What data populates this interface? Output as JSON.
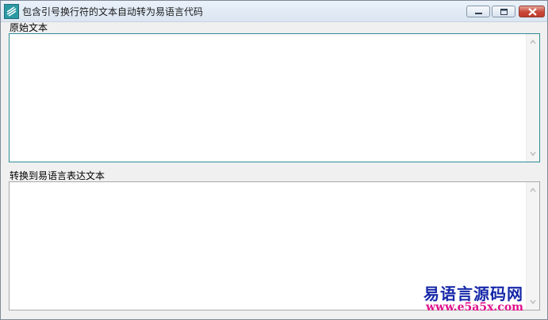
{
  "window": {
    "title": "包含引号换行符的文本自动转为易语言代码",
    "icon": "app-icon"
  },
  "controls": {
    "minimize": "minimize-icon",
    "maximize": "maximize-icon",
    "close": "close-icon"
  },
  "source": {
    "label": "原始文本",
    "value": ""
  },
  "output": {
    "label": "转换到易语言表达文本",
    "value": ""
  },
  "watermark": {
    "site_name": "易语言源码网",
    "url": "www.e5a5x.com"
  },
  "colors": {
    "title_bar": "#dbe6f2",
    "close_button": "#c7473a",
    "focus_border": "#2f8c96",
    "watermark_primary": "#1628a8",
    "watermark_secondary": "#e0108a"
  }
}
